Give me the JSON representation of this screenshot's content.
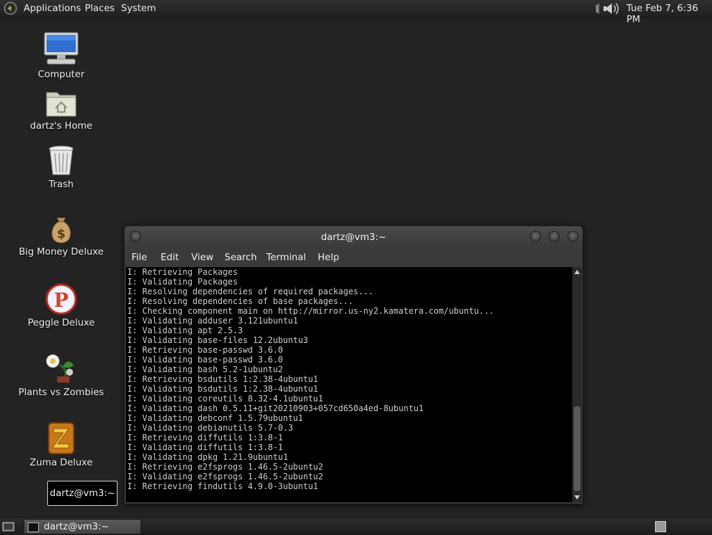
{
  "top_panel": {
    "menus": [
      "Applications",
      "Places",
      "System"
    ],
    "clock": "Tue Feb  7,  6:36 PM"
  },
  "desktop": {
    "icons": [
      {
        "label": "Computer",
        "icon": "computer-icon"
      },
      {
        "label": "dartz's Home",
        "icon": "home-folder-icon"
      },
      {
        "label": "Trash",
        "icon": "trash-icon"
      },
      {
        "label": "Big Money Deluxe",
        "icon": "money-bag-icon"
      },
      {
        "label": "Peggle Deluxe",
        "icon": "peggle-icon"
      },
      {
        "label": "Plants vs Zombies",
        "icon": "plants-vs-zombies-icon"
      },
      {
        "label": "Zuma Deluxe",
        "icon": "zuma-icon"
      }
    ]
  },
  "terminal": {
    "title": "dartz@vm3:~",
    "menu": [
      "File",
      "Edit",
      "View",
      "Search",
      "Terminal",
      "Help"
    ],
    "lines": [
      "I: Retrieving Packages",
      "I: Validating Packages",
      "I: Resolving dependencies of required packages...",
      "I: Resolving dependencies of base packages...",
      "I: Checking component main on http://mirror.us-ny2.kamatera.com/ubuntu...",
      "I: Validating adduser 3.121ubuntu1",
      "I: Validating apt 2.5.3",
      "I: Validating base-files 12.2ubuntu3",
      "I: Retrieving base-passwd 3.6.0",
      "I: Validating base-passwd 3.6.0",
      "I: Validating bash 5.2-1ubuntu2",
      "I: Retrieving bsdutils 1:2.38-4ubuntu1",
      "I: Validating bsdutils 1:2.38-4ubuntu1",
      "I: Validating coreutils 8.32-4.1ubuntu1",
      "I: Validating dash 0.5.11+git20210903+057cd650a4ed-8ubuntu1",
      "I: Validating debconf 1.5.79ubuntu1",
      "I: Validating debianutils 5.7-0.3",
      "I: Retrieving diffutils 1:3.8-1",
      "I: Validating diffutils 1:3.8-1",
      "I: Validating dpkg 1.21.9ubuntu1",
      "I: Retrieving e2fsprogs 1.46.5-2ubuntu2",
      "I: Validating e2fsprogs 1.46.5-2ubuntu2",
      "I: Retrieving findutils 4.9.0-3ubuntu1"
    ]
  },
  "tooltip": {
    "text": "dartz@vm3:~"
  },
  "taskbar": {
    "items": [
      {
        "label": "dartz@vm3:~"
      }
    ]
  }
}
